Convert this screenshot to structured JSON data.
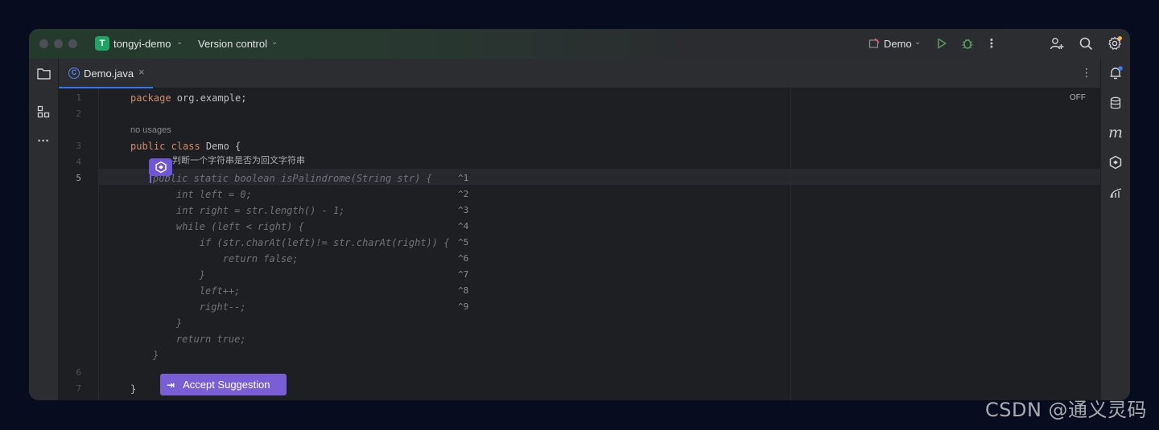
{
  "titlebar": {
    "project_badge": "T",
    "project_name": "tongyi-demo",
    "version_control": "Version control",
    "run_config": "Demo",
    "icons": [
      "run-icon",
      "debug-icon",
      "more-vertical-icon",
      "add-user-icon",
      "search-icon",
      "settings-icon"
    ]
  },
  "tabs": [
    {
      "label": "Demo.java",
      "icon": "java-class-icon",
      "active": true
    }
  ],
  "editor": {
    "line_numbers": [
      "1",
      "2",
      "3",
      "4",
      "5",
      "6",
      "7"
    ],
    "current_line": "5",
    "usage_hint": "no usages",
    "comment_text": "判断一个字符串是否为回文字符串",
    "code": {
      "line1_kw": "package",
      "line1_rest": " org.example;",
      "line3_kw": "public class",
      "line3_rest": " Demo {",
      "line7": "}"
    },
    "suggestion_lines": [
      "public static boolean isPalindrome(String str) {",
      "    int left = 0;",
      "    int right = str.length() - 1;",
      "    while (left < right) {",
      "        if (str.charAt(left)!= str.charAt(right)) {",
      "            return false;",
      "        }",
      "        left++;",
      "        right--;",
      "    }",
      "    return true;",
      "}"
    ],
    "shortcut_hints": [
      "^1",
      "^2",
      "^3",
      "^4",
      "^5",
      "^6",
      "^7",
      "^8",
      "^9"
    ],
    "status_off": "OFF",
    "accept_button": "Accept Suggestion"
  },
  "watermark": "CSDN @通义灵码",
  "colors": {
    "background": "#070d1f",
    "editor_bg": "#1e1f22",
    "keyword": "#cf8e6d",
    "accent_tab": "#3574f0",
    "ai_purple": "#7a5ed6"
  }
}
